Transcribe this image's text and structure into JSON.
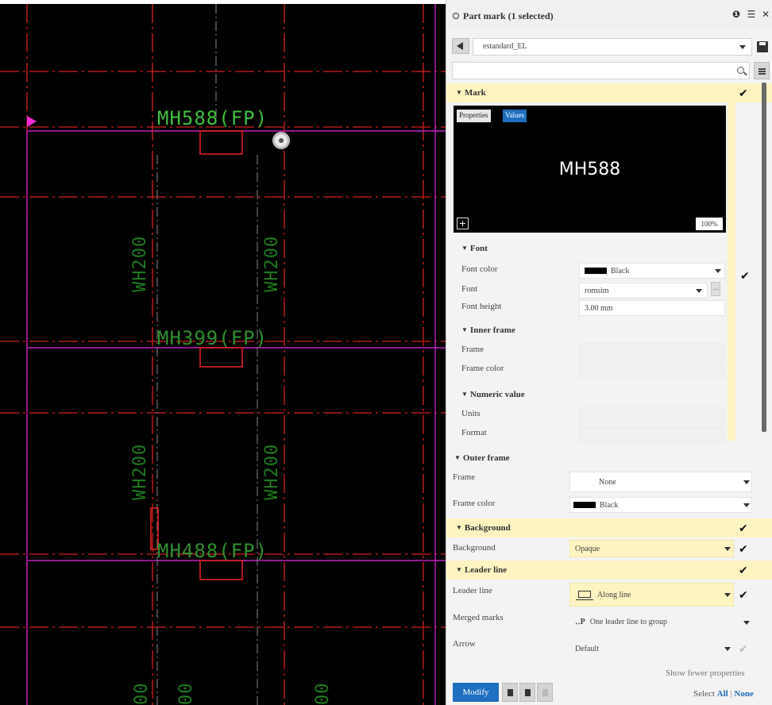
{
  "canvas": {
    "marks": [
      {
        "text": "MH588(FP)"
      },
      {
        "text": "MH399(FP)"
      },
      {
        "text": "MH488(FP)"
      }
    ],
    "profiles": [
      "WH200",
      "WH200",
      "WH200",
      "WH200"
    ],
    "bottom_profiles": [
      "00",
      "00",
      "00"
    ],
    "colors": {
      "background": "#000000",
      "grid_red": "#d41f1f",
      "grid_magenta": "#c020c0",
      "text_green": "#3fbf3f"
    }
  },
  "panel": {
    "title": "Part mark (1 selected)",
    "title_icons": [
      "help-icon",
      "list-icon",
      "close-icon"
    ],
    "preset": "estandard_EL",
    "search": {
      "placeholder": ""
    },
    "mark_section": {
      "label": "Mark",
      "preview": {
        "tab_properties": "Properties",
        "tab_values": "Values",
        "text": "MH588",
        "add_label": "+",
        "zoom": "100%"
      },
      "font": {
        "label": "Font",
        "font_color_label": "Font color",
        "font_color_value": "Black",
        "font_label": "Font",
        "font_value": "romsim",
        "font_height_label": "Font height",
        "font_height_value": "3.00 mm"
      },
      "inner_frame": {
        "label": "Inner frame",
        "frame_label": "Frame",
        "frame_color_label": "Frame color"
      },
      "numeric_value": {
        "label": "Numeric value",
        "units_label": "Units",
        "format_label": "Format"
      }
    },
    "outer_frame": {
      "label": "Outer frame",
      "frame_label": "Frame",
      "frame_value": "None",
      "frame_color_label": "Frame color",
      "frame_color_value": "Black"
    },
    "background": {
      "label": "Background",
      "field_label": "Background",
      "value": "Opaque"
    },
    "leader_line": {
      "label": "Leader line",
      "leader_label": "Leader line",
      "leader_value": "Along line",
      "merged_label": "Merged marks",
      "merged_value": "One leader line to group",
      "arrow_label": "Arrow",
      "arrow_value": "Default"
    },
    "footer": {
      "show_fewer": "Show fewer properties",
      "select_label": "Select",
      "select_all": "All",
      "select_none": "None",
      "modify": "Modify"
    },
    "colors": {
      "accent": "#1e6fc0",
      "highlight": "#fdf4c2",
      "panel_bg": "#f3f3f3"
    }
  }
}
